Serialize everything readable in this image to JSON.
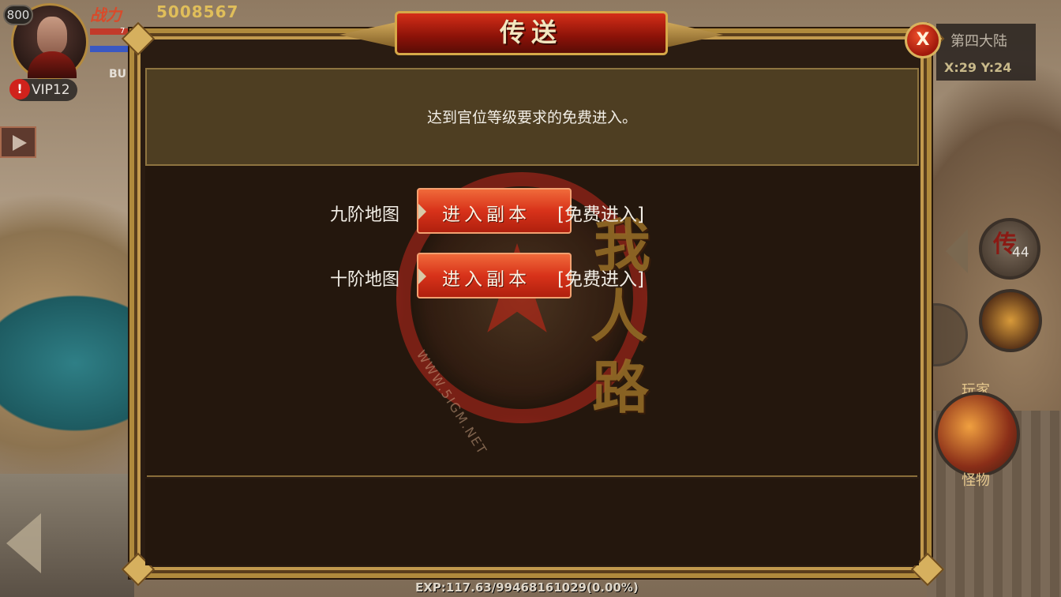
{
  "hud": {
    "level": "800",
    "power_label": "战力",
    "power_value": "5008567",
    "hp_partial": "7",
    "name_partial": "BU",
    "vip_alert": "!",
    "vip_label": "VIP12",
    "region_name": "第四大陆",
    "region_coords": "X:29 Y:24",
    "skill_char": "传",
    "skill_count": "44",
    "player_label": "玩家",
    "monster_label": "怪物",
    "exp_text": "EXP:117.63/99468161029(0.00%)"
  },
  "dialog": {
    "title": "传送",
    "close_label": "X",
    "notice": "达到官位等级要求的免费进入。",
    "rows": [
      {
        "map": "九阶地图",
        "button": "进入副本",
        "note": "[免费进入]"
      },
      {
        "map": "十阶地图",
        "button": "进入副本",
        "note": "[免费进入]"
      }
    ]
  },
  "watermark": {
    "chars": [
      "我",
      "人",
      "路"
    ],
    "url": "WWW.5IGM.NET"
  },
  "colors": {
    "dialog_bg": "#2a1c12",
    "frame_gold": "#b08a3c",
    "button_red": "#d8321a",
    "title_red": "#8a1208"
  }
}
